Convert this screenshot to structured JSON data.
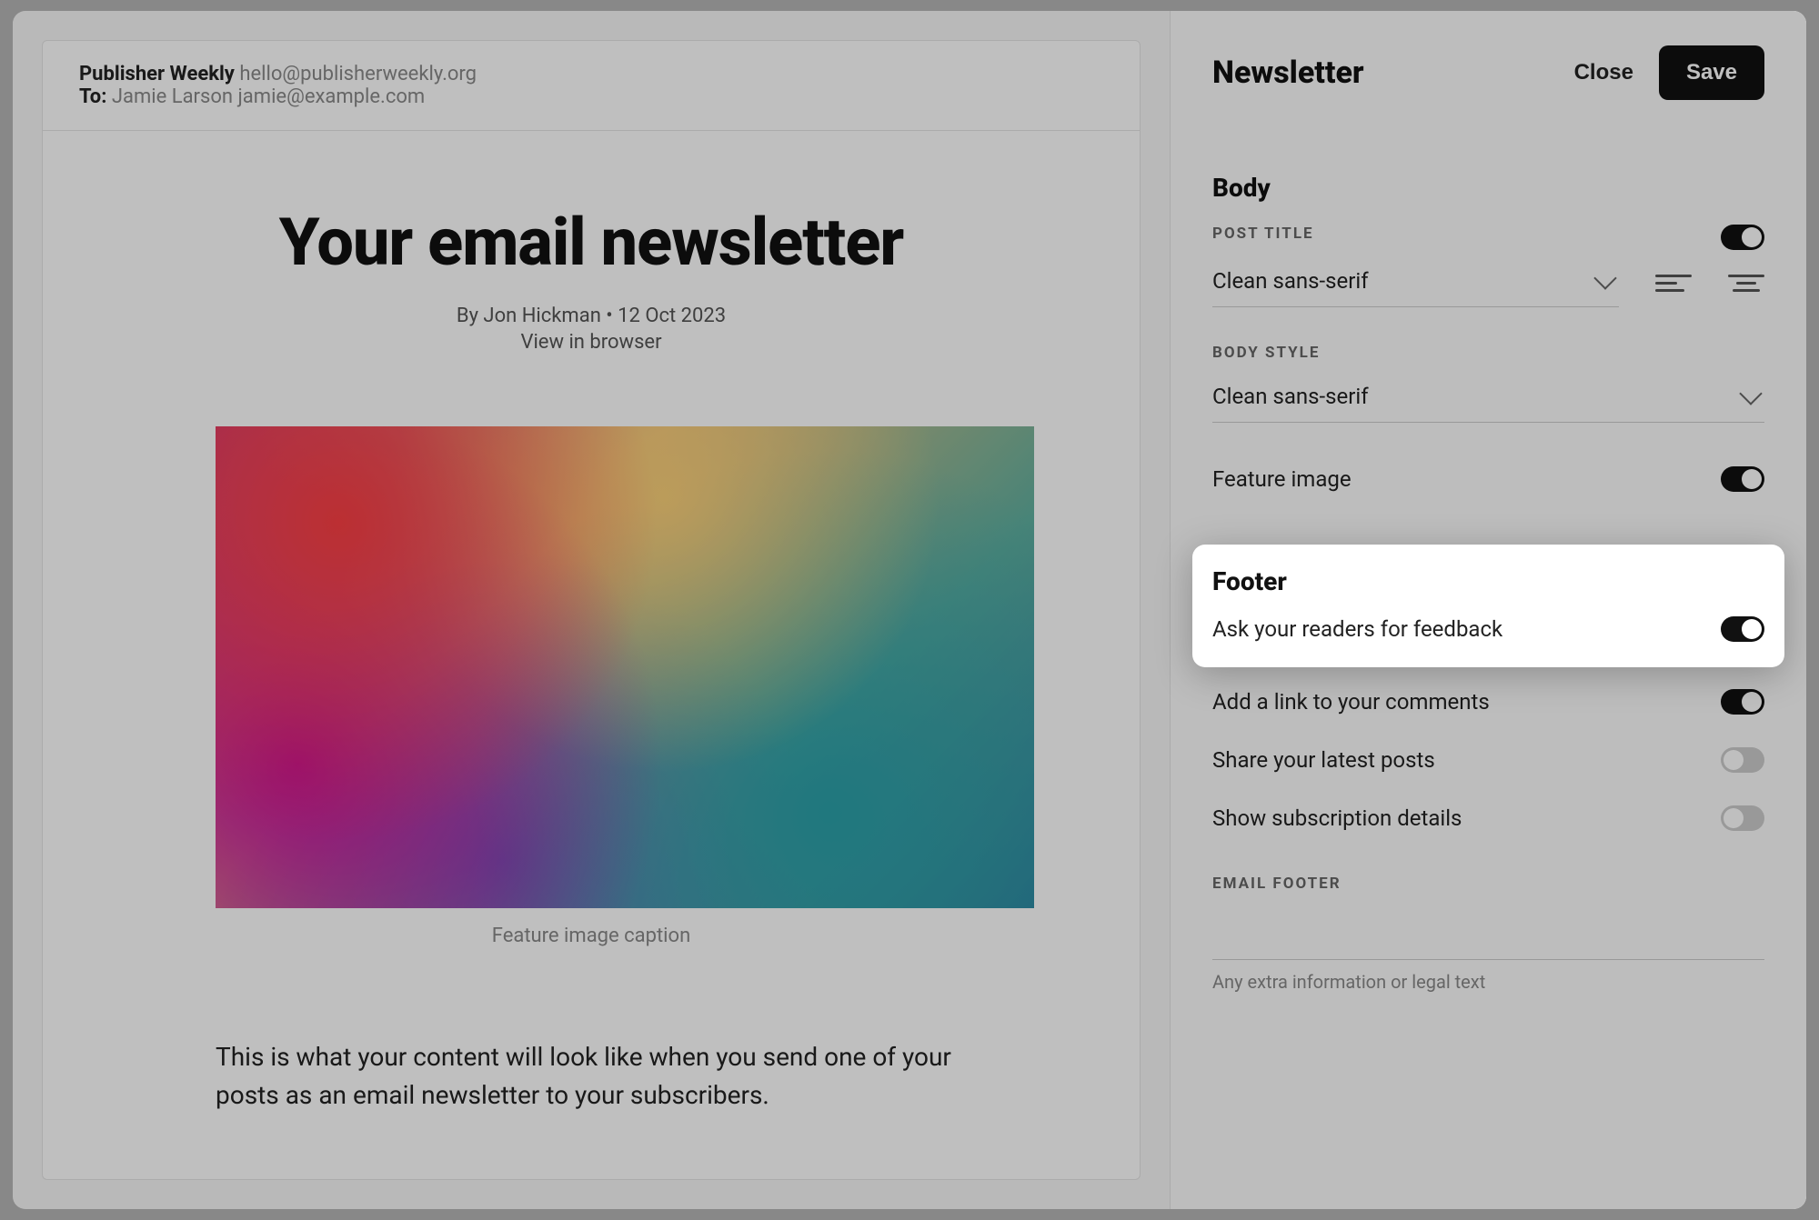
{
  "panel": {
    "title": "Newsletter",
    "close_label": "Close",
    "save_label": "Save"
  },
  "email": {
    "from_name": "Publisher Weekly",
    "from_email": "hello@publisherweekly.org",
    "to_label": "To:",
    "to_name": "Jamie Larson",
    "to_email": "jamie@example.com",
    "title": "Your email newsletter",
    "byline": "By Jon Hickman • 12 Oct 2023",
    "view_in_browser": "View in browser",
    "feature_caption": "Feature image caption",
    "body_preview": "This is what your content will look like when you send one of your posts as an email newsletter to your subscribers."
  },
  "body_section": {
    "heading": "Body",
    "post_title_label": "POST TITLE",
    "post_title_font": "Clean sans-serif",
    "post_title_toggle": true,
    "body_style_label": "BODY STYLE",
    "body_style_font": "Clean sans-serif",
    "feature_image_label": "Feature image",
    "feature_image_toggle": true
  },
  "footer_section": {
    "heading": "Footer",
    "items": [
      {
        "label": "Ask your readers for feedback",
        "on": true
      },
      {
        "label": "Add a link to your comments",
        "on": true
      },
      {
        "label": "Share your latest posts",
        "on": false
      },
      {
        "label": "Show subscription details",
        "on": false
      }
    ],
    "email_footer_label": "EMAIL FOOTER",
    "helper_text": "Any extra information or legal text"
  }
}
